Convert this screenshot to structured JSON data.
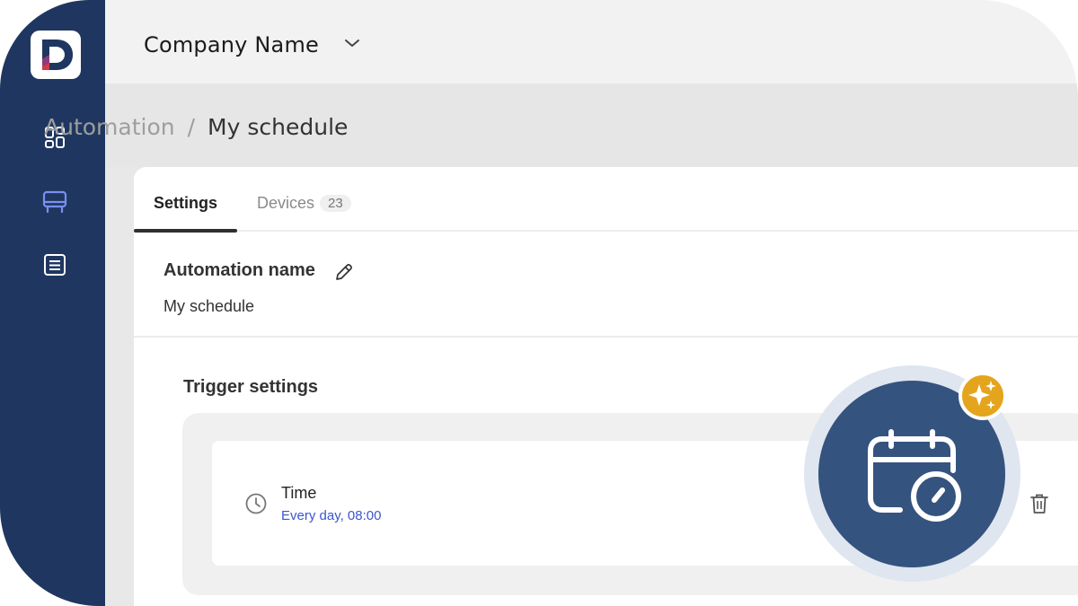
{
  "app": {
    "logo_icon": "company-logo",
    "accent_color": "#1f3760",
    "link_color": "#3a56d1"
  },
  "sidebar": {
    "items": [
      {
        "icon": "dashboard-grid-icon",
        "active": false
      },
      {
        "icon": "device-icon",
        "active": true
      },
      {
        "icon": "list-icon",
        "active": false
      }
    ]
  },
  "header": {
    "company_name": "Company Name",
    "dropdown_icon": "chevron-down-icon"
  },
  "breadcrumb": {
    "parent": "Automation",
    "separator": "/",
    "current": "My schedule"
  },
  "tabs": [
    {
      "label": "Settings",
      "active": true
    },
    {
      "label": "Devices",
      "badge": "23",
      "active": false
    }
  ],
  "automation": {
    "name_label": "Automation name",
    "name_value": "My schedule",
    "edit_icon": "pencil-icon"
  },
  "trigger": {
    "section_title": "Trigger settings",
    "items": [
      {
        "icon": "clock-icon",
        "name": "Time",
        "description": "Every day, 08:00",
        "action_icon": "trash-icon"
      }
    ]
  },
  "feature_badge": {
    "icon": "calendar-clock-icon",
    "badge_icon": "sparkle-icon",
    "badge_color": "#e4a51d"
  }
}
